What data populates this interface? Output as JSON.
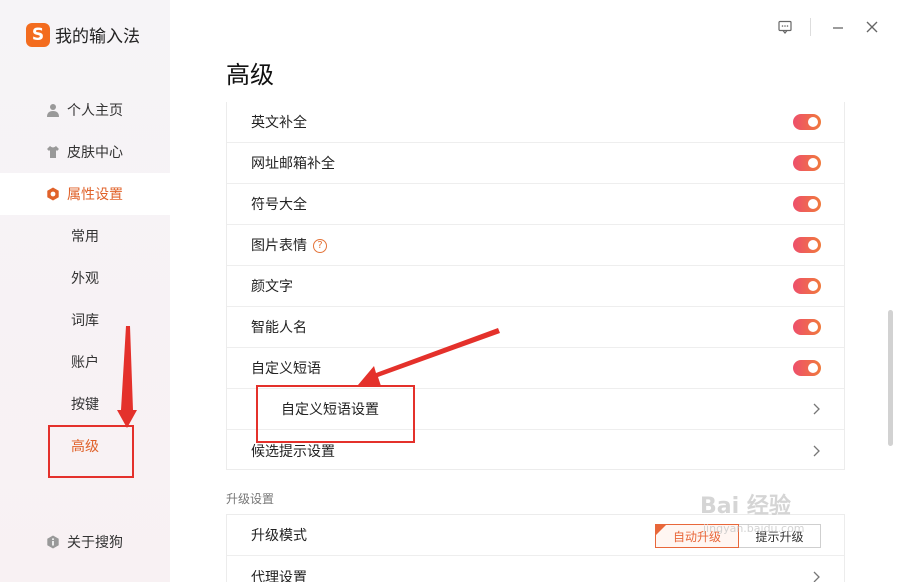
{
  "app": {
    "logo_letter": "S",
    "name": "我的输入法"
  },
  "window_controls": [
    "feedback-icon",
    "minimize-icon",
    "close-icon"
  ],
  "sidebar": {
    "items": [
      {
        "label": "个人主页",
        "icon": "person-icon"
      },
      {
        "label": "皮肤中心",
        "icon": "shirt-icon"
      },
      {
        "label": "属性设置",
        "icon": "hexagon-settings-icon",
        "active": true
      }
    ],
    "sub_items": [
      {
        "label": "常用"
      },
      {
        "label": "外观"
      },
      {
        "label": "词库"
      },
      {
        "label": "账户"
      },
      {
        "label": "按键"
      },
      {
        "label": "高级",
        "current": true
      }
    ],
    "about": {
      "label": "关于搜狗",
      "icon": "info-icon"
    }
  },
  "page": {
    "title": "高级",
    "rows": [
      {
        "label": "英文补全",
        "type": "toggle",
        "on": true
      },
      {
        "label": "网址邮箱补全",
        "type": "toggle",
        "on": true
      },
      {
        "label": "符号大全",
        "type": "toggle",
        "on": true
      },
      {
        "label": "图片表情",
        "type": "toggle",
        "on": true,
        "help": "?"
      },
      {
        "label": "颜文字",
        "type": "toggle",
        "on": true
      },
      {
        "label": "智能人名",
        "type": "toggle",
        "on": true
      },
      {
        "label": "自定义短语",
        "type": "toggle",
        "on": true
      },
      {
        "label": "自定义短语设置",
        "type": "link"
      },
      {
        "label": "候选提示设置",
        "type": "link"
      }
    ],
    "upgrade_section": {
      "title": "升级设置",
      "rows": [
        {
          "label": "升级模式",
          "options": [
            "自动升级",
            "提示升级"
          ],
          "selected": "自动升级"
        },
        {
          "label": "代理设置",
          "type": "link"
        }
      ]
    }
  },
  "watermark": {
    "text": "Bai 经验",
    "sub": "jingyan.baidu.com"
  },
  "colors": {
    "accent": "#e0622a",
    "toggle_start": "#ee4f6b",
    "toggle_end": "#f07a3c",
    "annotation": "#e4312b"
  }
}
